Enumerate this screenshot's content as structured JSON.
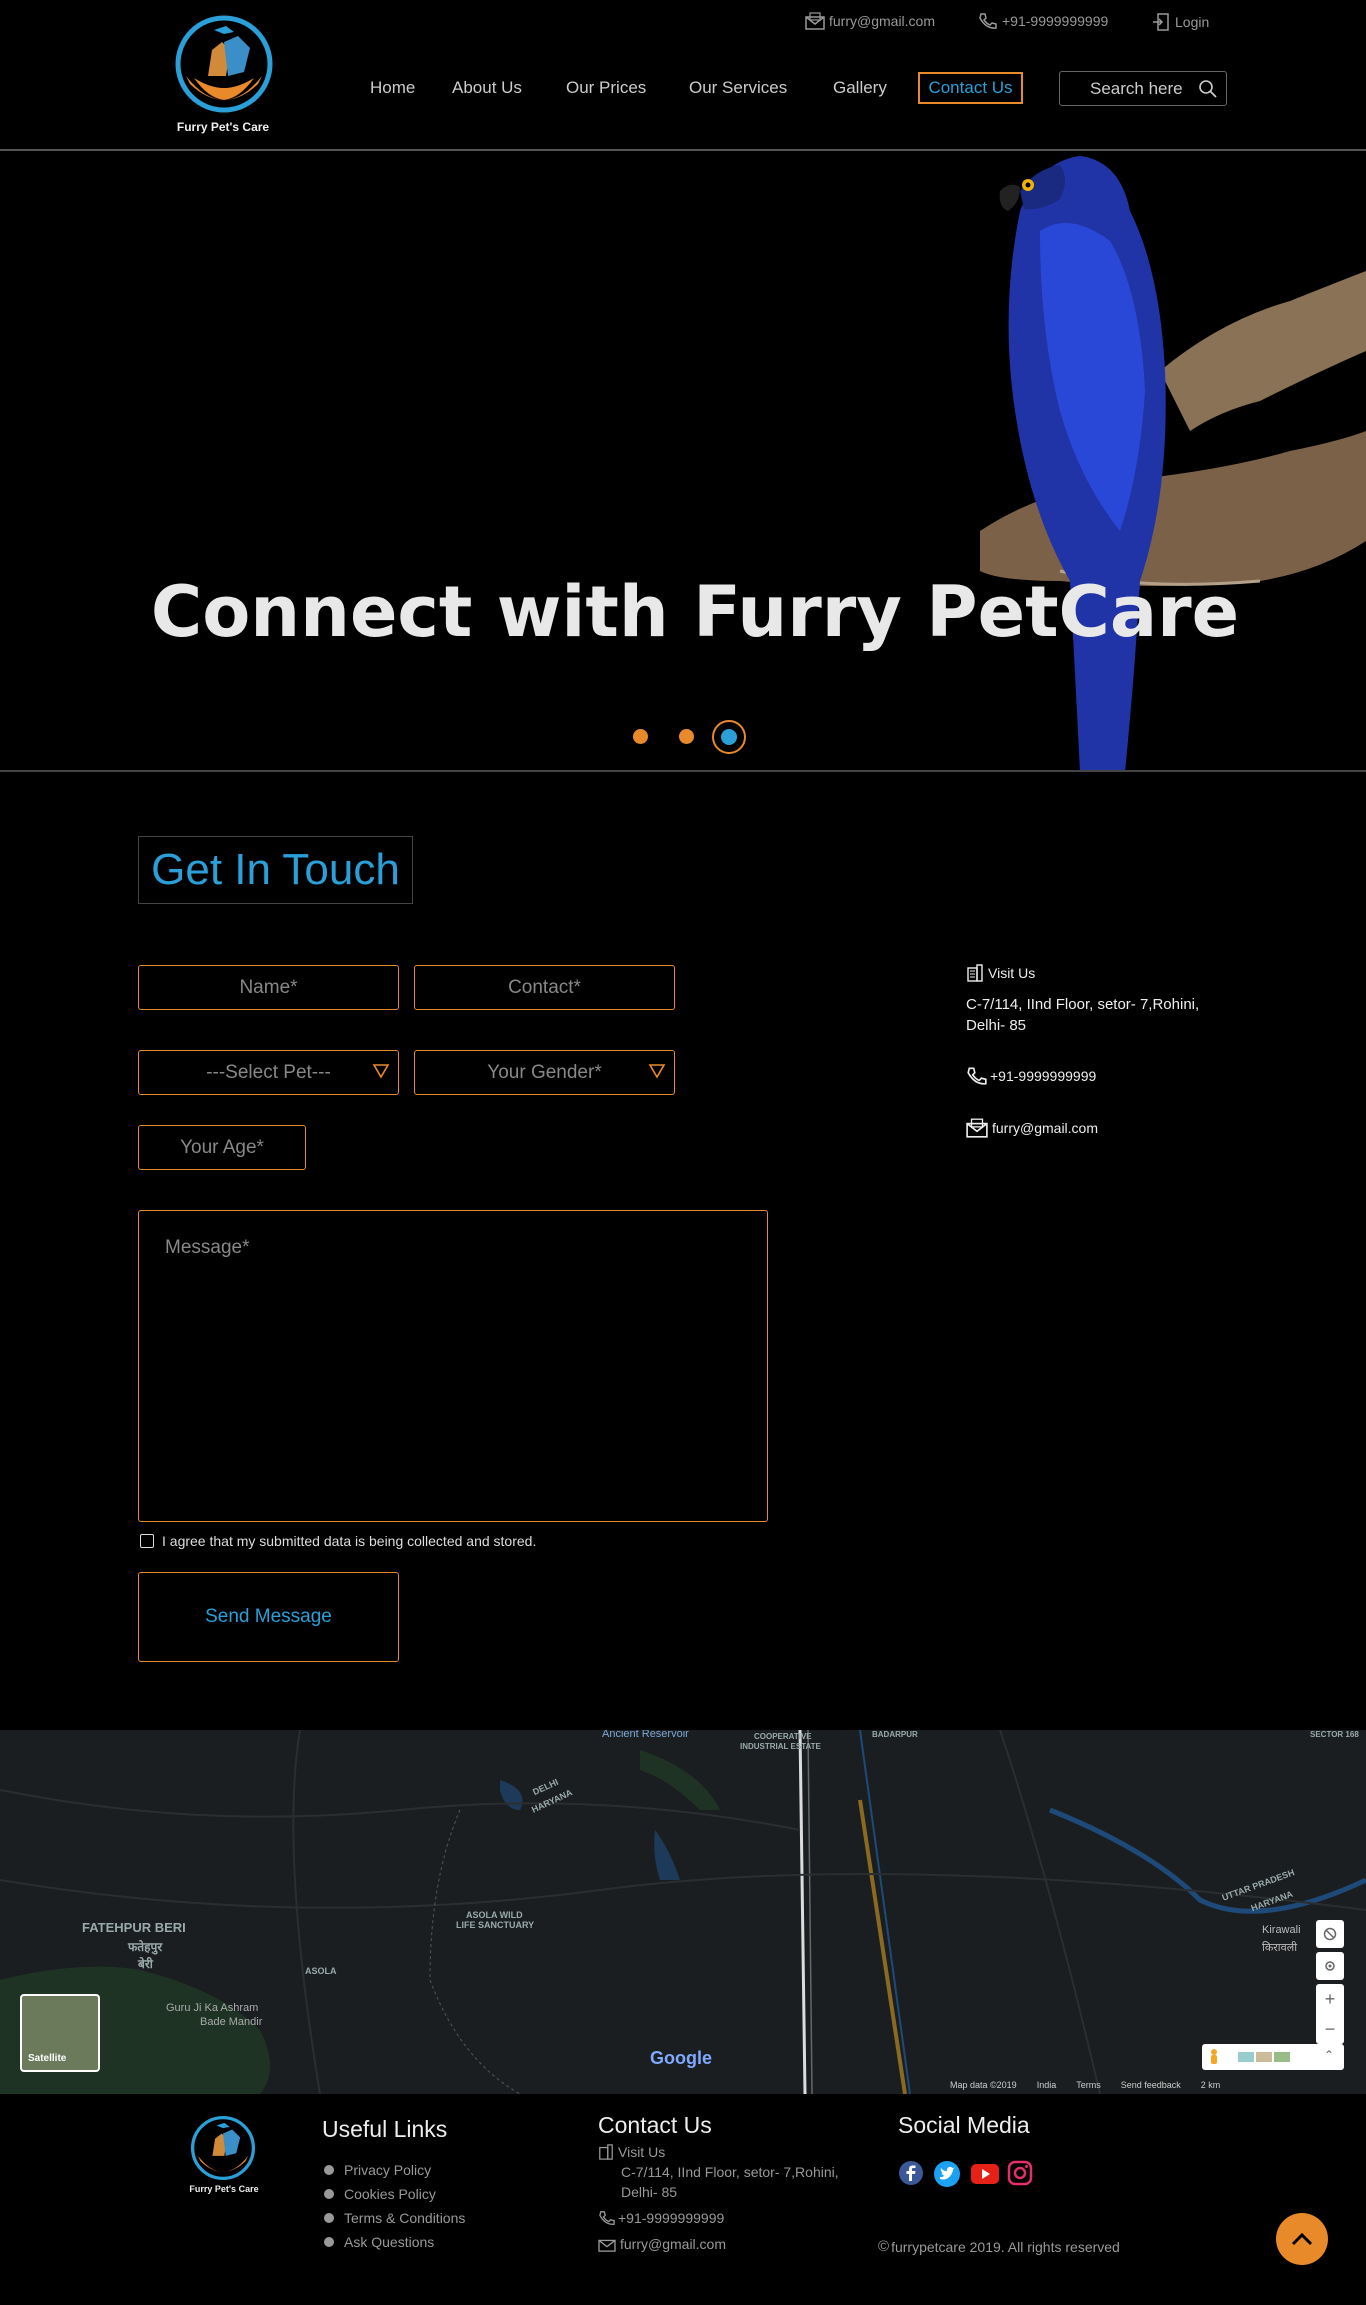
{
  "brand": {
    "name": "Furry Pet's Care"
  },
  "topbar": {
    "email": "furry@gmail.com",
    "phone": "+91-9999999999",
    "login": "Login"
  },
  "nav": {
    "items": [
      "Home",
      "About Us",
      "Our Prices",
      "Our Services",
      "Gallery"
    ],
    "active": "Contact Us",
    "search_placeholder": "Search here"
  },
  "hero": {
    "title": "Connect with Furry PetCare",
    "slides": 3,
    "active_slide": 3
  },
  "form": {
    "heading": "Get In Touch",
    "name_placeholder": "Name*",
    "contact_placeholder": "Contact*",
    "pet_select": "---Select Pet---",
    "gender_select": "Your Gender*",
    "age_placeholder": "Your Age*",
    "message_placeholder": "Message*",
    "agree_text": "I agree that my submitted data is being collected and stored.",
    "send_label": "Send Message"
  },
  "contact_info": {
    "visit_label": "Visit Us",
    "address_line1": "C-7/114, IInd Floor, setor- 7,Rohini,",
    "address_line2": "Delhi- 85",
    "phone": "+91-9999999999",
    "email": "furry@gmail.com"
  },
  "map": {
    "labels": [
      "FATEHPUR BERI",
      "फतेहपुर",
      "बेरी",
      "ASOLA WILD",
      "LIFE SANCTUARY",
      "ASOLA",
      "Guru Ji Ka Ashram",
      "Bade Mandir",
      "DELHI",
      "HARYANA",
      "COOPERATIVE",
      "INDUSTRIAL ESTATE",
      "BADARPUR",
      "UTTAR PRADESH",
      "HARYANA",
      "Kirawali",
      "किरावली",
      "Ancient Reservoir",
      "SECTOR 168"
    ],
    "satellite_label": "Satellite",
    "google": "Google",
    "footer_items": [
      "Map data ©2019",
      "India",
      "Terms",
      "Send feedback",
      "2 km"
    ]
  },
  "footer": {
    "brand": "Furry Pet's Care",
    "useful_heading": "Useful Links",
    "useful_links": [
      "Privacy Policy",
      "Cookies Policy",
      "Terms & Conditions",
      "Ask Questions"
    ],
    "contact_heading": "Contact Us",
    "visit_label": "Visit Us",
    "address_line1": "C-7/114, IInd Floor, setor- 7,Rohini,",
    "address_line2": "Delhi- 85",
    "phone": "+91-9999999999",
    "email": "furry@gmail.com",
    "social_heading": "Social Media",
    "copyright": "furrypetcare 2019. All rights reserved"
  },
  "colors": {
    "accent_orange": "#e88a2a",
    "accent_blue": "#2a9fd8"
  }
}
